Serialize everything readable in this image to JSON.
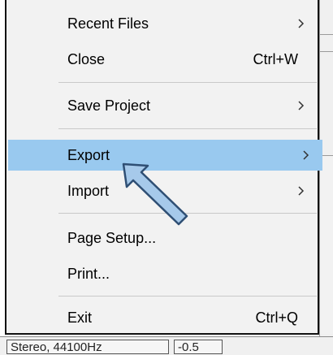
{
  "menu": {
    "items": [
      {
        "label": "Recent Files",
        "shortcut": "",
        "has_submenu": true,
        "highlighted": false
      },
      {
        "label": "Close",
        "shortcut": "Ctrl+W",
        "has_submenu": false,
        "highlighted": false
      },
      {
        "label": "Save Project",
        "shortcut": "",
        "has_submenu": true,
        "highlighted": false
      },
      {
        "label": "Export",
        "shortcut": "",
        "has_submenu": true,
        "highlighted": true
      },
      {
        "label": "Import",
        "shortcut": "",
        "has_submenu": true,
        "highlighted": false
      },
      {
        "label": "Page Setup...",
        "shortcut": "",
        "has_submenu": false,
        "highlighted": false
      },
      {
        "label": "Print...",
        "shortcut": "",
        "has_submenu": false,
        "highlighted": false
      },
      {
        "label": "Exit",
        "shortcut": "Ctrl+Q",
        "has_submenu": false,
        "highlighted": false
      }
    ]
  },
  "status_bar": {
    "format_text": "Stereo, 44100Hz",
    "value_text": "-0.5"
  },
  "colors": {
    "highlight": "#99c9ef",
    "menu_bg": "#f2f2f2",
    "arrow_fill": "#a6c9ea",
    "arrow_stroke": "#2f4f74"
  },
  "icons": {
    "submenu_chevron": "chevron-right-icon",
    "annotation": "arrow-pointer-icon"
  }
}
